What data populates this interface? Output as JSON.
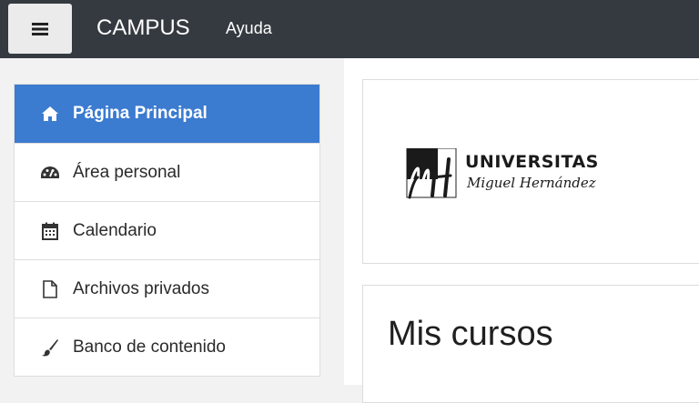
{
  "header": {
    "menu_icon": "hamburger-icon",
    "brand": "CAMPUS",
    "help": "Ayuda"
  },
  "sidebar": {
    "items": [
      {
        "label": "Página Principal",
        "icon": "home-icon",
        "active": true
      },
      {
        "label": "Área personal",
        "icon": "dashboard-icon",
        "active": false
      },
      {
        "label": "Calendario",
        "icon": "calendar-icon",
        "active": false
      },
      {
        "label": "Archivos privados",
        "icon": "file-icon",
        "active": false
      },
      {
        "label": "Banco de contenido",
        "icon": "brush-icon",
        "active": false
      }
    ]
  },
  "main": {
    "logo": {
      "title": "UNIVERSITAS",
      "subtitle": "Miguel Hernández"
    },
    "courses_title": "Mis cursos"
  },
  "colors": {
    "topbar": "#343a40",
    "active": "#3b7bd0",
    "sidebar_bg": "#f2f2f2"
  }
}
